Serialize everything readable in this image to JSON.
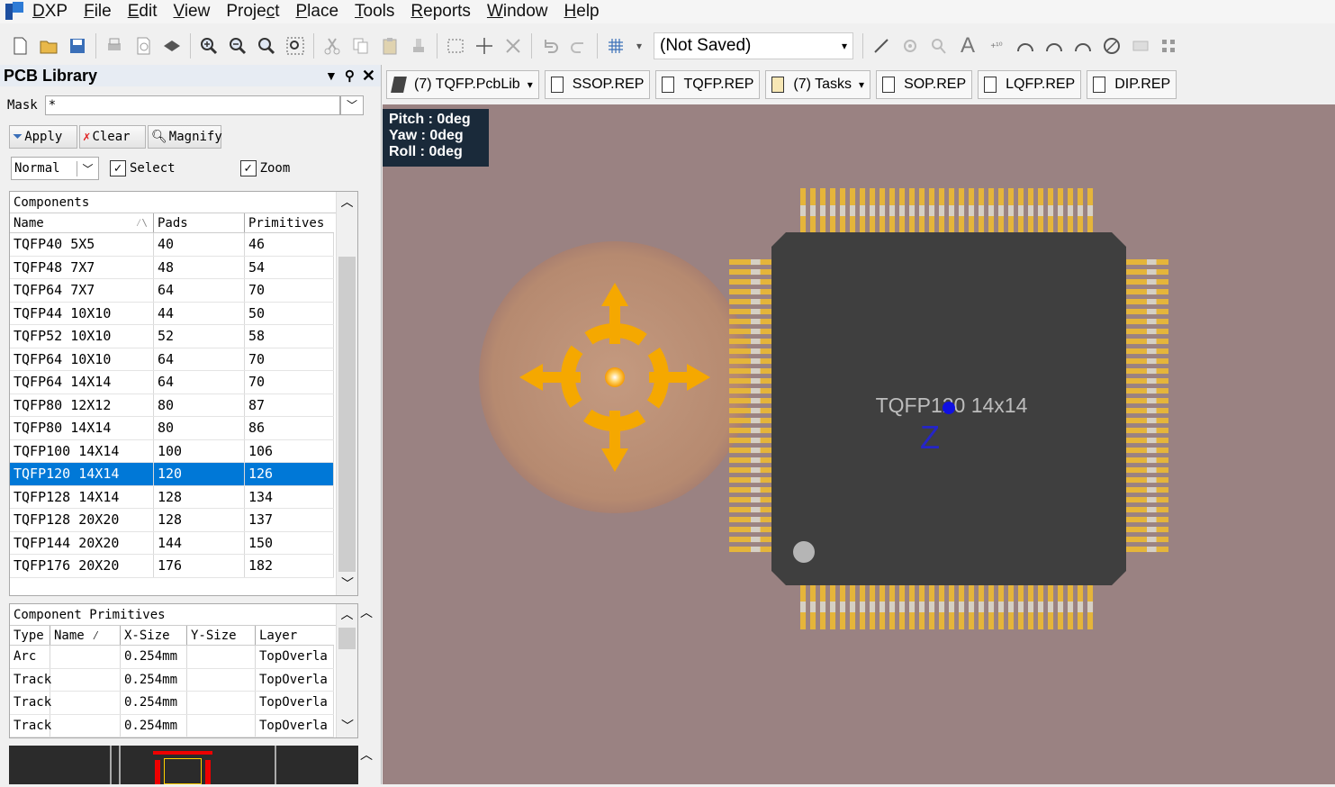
{
  "menu": {
    "items": [
      {
        "label": "DXP",
        "key": "D"
      },
      {
        "label": "File",
        "key": "F"
      },
      {
        "label": "Edit",
        "key": "E"
      },
      {
        "label": "View",
        "key": "V"
      },
      {
        "label": "Project",
        "key": "c"
      },
      {
        "label": "Place",
        "key": "P"
      },
      {
        "label": "Tools",
        "key": "T"
      },
      {
        "label": "Reports",
        "key": "R"
      },
      {
        "label": "Window",
        "key": "W"
      },
      {
        "label": "Help",
        "key": "H"
      }
    ]
  },
  "toolbar": {
    "variant_value": "(Not Saved)"
  },
  "panel": {
    "title": "PCB Library",
    "mask_label": "Mask",
    "mask_value": "*",
    "apply_label": "Apply",
    "clear_label": "Clear",
    "magnify_label": "Magnify",
    "mode_value": "Normal",
    "select_label": "Select",
    "zoom_label": "Zoom",
    "components": {
      "title": "Components",
      "columns": [
        "Name",
        "Pads",
        "Primitives"
      ],
      "rows": [
        [
          "TQFP40 5X5",
          "40",
          "46"
        ],
        [
          "TQFP48 7X7",
          "48",
          "54"
        ],
        [
          "TQFP64 7X7",
          "64",
          "70"
        ],
        [
          "TQFP44 10X10",
          "44",
          "50"
        ],
        [
          "TQFP52 10X10",
          "52",
          "58"
        ],
        [
          "TQFP64 10X10",
          "64",
          "70"
        ],
        [
          "TQFP64 14X14",
          "64",
          "70"
        ],
        [
          "TQFP80 12X12",
          "80",
          "87"
        ],
        [
          "TQFP80 14X14",
          "80",
          "86"
        ],
        [
          "TQFP100 14X14",
          "100",
          "106"
        ],
        [
          "TQFP120 14X14",
          "120",
          "126"
        ],
        [
          "TQFP128 14X14",
          "128",
          "134"
        ],
        [
          "TQFP128 20X20",
          "128",
          "137"
        ],
        [
          "TQFP144 20X20",
          "144",
          "150"
        ],
        [
          "TQFP176 20X20",
          "176",
          "182"
        ]
      ],
      "selected_index": 10
    },
    "primitives": {
      "title": "Component Primitives",
      "columns": [
        "Type",
        "Name",
        "X-Size",
        "Y-Size",
        "Layer"
      ],
      "rows": [
        [
          "Arc",
          "",
          "0.254mm",
          "",
          "TopOverla"
        ],
        [
          "Track",
          "",
          "0.254mm",
          "",
          "TopOverla"
        ],
        [
          "Track",
          "",
          "0.254mm",
          "",
          "TopOverla"
        ],
        [
          "Track",
          "",
          "0.254mm",
          "",
          "TopOverla"
        ]
      ]
    }
  },
  "tabs": [
    {
      "label": "(7) TQFP.PcbLib",
      "dropdown": true
    },
    {
      "label": "SSOP.REP"
    },
    {
      "label": "TQFP.REP"
    },
    {
      "label": "(7) Tasks",
      "dropdown": true
    },
    {
      "label": "SOP.REP"
    },
    {
      "label": "LQFP.REP"
    },
    {
      "label": "DIP.REP"
    }
  ],
  "viewer": {
    "pitch": "Pitch : 0deg",
    "yaw": "Yaw : 0deg",
    "roll": "Roll : 0deg",
    "component_label": "TQFP120 14x14",
    "axis_label": "Z",
    "pins_per_side": 30
  },
  "colors": {
    "accent": "#0078d7",
    "pin_gold": "#e5b53a",
    "body": "#3f3f3f",
    "board": "#9a8282",
    "nav_orange": "#f5a800"
  }
}
